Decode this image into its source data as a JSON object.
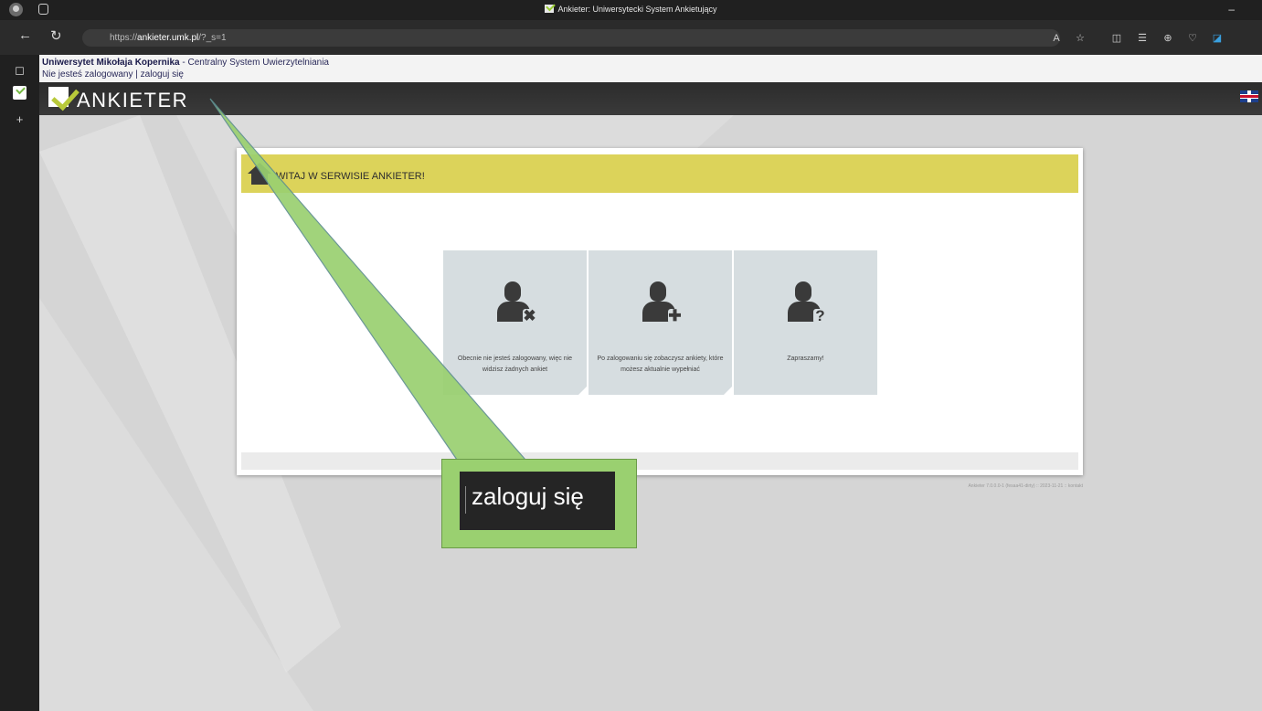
{
  "browser": {
    "window_title": "Ankieter: Uniwersytecki System Ankietujący",
    "url_scheme": "https://",
    "url_host": "ankieter.umk.pl",
    "url_path": "/?_s=1"
  },
  "cas_bar": {
    "university": "Uniwersytet Mikołaja Kopernika",
    "system": " - Centralny System Uwierzytelniania",
    "status": "Nie jesteś zalogowany",
    "separator": " | ",
    "login_link": "zaloguj się"
  },
  "header": {
    "logo_text": "ANKIETER",
    "logo_color": "#b8c93a"
  },
  "welcome": {
    "title": "WITAJ W SERWISIE ANKIETER!"
  },
  "tiles": [
    {
      "text": "Obecnie nie jesteś zalogowany, więc nie widzisz żadnych ankiet",
      "badge": "✖",
      "icon": "user-x-icon"
    },
    {
      "text": "Po zalogowaniu się zobaczysz ankiety, które możesz aktualnie wypełniać",
      "badge": "✚",
      "icon": "user-plus-icon"
    },
    {
      "text": "Zapraszamy!",
      "badge": "?",
      "icon": "user-question-icon"
    }
  ],
  "footer": {
    "version": "Ankieter 7.0.0.0-1 (fesaa41-dirty) :: 2023-11-21 :: kontakt"
  },
  "callout": {
    "text": "zaloguj się",
    "color": "#9ad070"
  }
}
